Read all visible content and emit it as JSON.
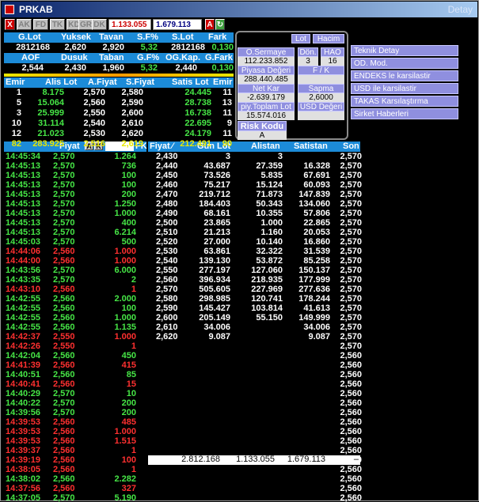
{
  "title": "PRKAB",
  "title_right": "Detay",
  "toolbar": {
    "close": "X",
    "buttons": [
      "AK",
      "FD",
      "TK",
      "KD",
      "GR",
      "DK"
    ],
    "field1": "1.133.055",
    "field2": "1.679.113",
    "a_btn": "A",
    "arrow": "↻"
  },
  "summary1": {
    "headers": [
      "G.Lot",
      "Yuksek",
      "Tavan",
      "S.F%",
      "S.Lot",
      "Fark"
    ],
    "values": [
      "2812168",
      "2,620",
      "2,920",
      "5,32",
      "2812168",
      "0,130"
    ]
  },
  "summary2": {
    "headers": [
      "AOF",
      "Dusuk",
      "Taban",
      "G.F%",
      "OG.Kap.",
      "G.Fark"
    ],
    "values": [
      "2,544",
      "2,430",
      "1,960",
      "5,32",
      "2,440",
      "0,130"
    ]
  },
  "orderbook": {
    "headers": [
      "Emir",
      "Alis Lot",
      "A.Fiyat",
      "S.Fiyat",
      "Satis Lot",
      "Emir"
    ],
    "rows": [
      [
        "1",
        "8.175",
        "2,570",
        "2,580",
        "24.445",
        "11"
      ],
      [
        "5",
        "15.064",
        "2,560",
        "2,590",
        "28.738",
        "13"
      ],
      [
        "3",
        "25.999",
        "2,550",
        "2,600",
        "16.738",
        "11"
      ],
      [
        "10",
        "31.114",
        "2,540",
        "2,610",
        "22.695",
        "9"
      ],
      [
        "12",
        "21.023",
        "2,530",
        "2,620",
        "24.179",
        "11"
      ]
    ],
    "totals": [
      "82",
      "283.925",
      "2,516",
      "2,619",
      "212.491",
      "90"
    ]
  },
  "info": {
    "lot_btn": "Lot",
    "hacim_btn": "Hacim",
    "osermaye_label": "O.Sermaye",
    "osermaye_value": "112.233.852",
    "don_label": "Dön.",
    "don_value": "3",
    "hao_label": "HAO",
    "hao_value": "16",
    "piyasa_label": "Piyasa Değeri",
    "piyasa_value": "288.440.485",
    "fk_label": "F / K",
    "fk_value": "",
    "netkar_label": "Net Kar",
    "netkar_value": "-2.639.179",
    "sapma_label": "Sapma",
    "sapma_value": "2,6000",
    "toplamlot_label": "piy.Toplam Lot",
    "toplamlot_value": "15.574.016",
    "usd_label": "USD Değeri",
    "usd_value": "",
    "risk_label": "Risk Kodu",
    "risk_value": "A"
  },
  "right_buttons": [
    "Teknik Detay",
    "OD. Mod.",
    "ENDEKS le karsilastir",
    "USD ile karsilastir",
    "TAKAS Karsılaştırma",
    "Sirket Haberleri"
  ],
  "ticks_header": {
    "fiyat": "Fiyat",
    "a": "A",
    "k": "K",
    "fk": "FK"
  },
  "ticks": [
    [
      "14:45:34",
      "2,570",
      "1.264",
      "g"
    ],
    [
      "14:45:13",
      "2,570",
      "736",
      "g"
    ],
    [
      "14:45:13",
      "2,570",
      "100",
      "g"
    ],
    [
      "14:45:13",
      "2,570",
      "100",
      "g"
    ],
    [
      "14:45:13",
      "2,570",
      "200",
      "g"
    ],
    [
      "14:45:13",
      "2,570",
      "1.250",
      "g"
    ],
    [
      "14:45:13",
      "2,570",
      "1.000",
      "g"
    ],
    [
      "14:45:13",
      "2,570",
      "400",
      "g"
    ],
    [
      "14:45:13",
      "2,570",
      "6.214",
      "g"
    ],
    [
      "14:45:03",
      "2,570",
      "500",
      "g"
    ],
    [
      "14:44:06",
      "2,560",
      "1.000",
      "r"
    ],
    [
      "14:44:00",
      "2,560",
      "1.000",
      "r"
    ],
    [
      "14:43:56",
      "2,570",
      "6.000",
      "g"
    ],
    [
      "14:43:35",
      "2,570",
      "2",
      "g"
    ],
    [
      "14:43:10",
      "2,560",
      "1",
      "r"
    ],
    [
      "14:42:55",
      "2,560",
      "2.000",
      "g"
    ],
    [
      "14:42:55",
      "2,560",
      "100",
      "g"
    ],
    [
      "14:42:55",
      "2,560",
      "1.000",
      "g"
    ],
    [
      "14:42:55",
      "2,560",
      "1.135",
      "g"
    ],
    [
      "14:42:37",
      "2,550",
      "1.000",
      "r"
    ],
    [
      "14:42:26",
      "2,550",
      "1",
      "r"
    ],
    [
      "14:42:04",
      "2,560",
      "450",
      "g"
    ],
    [
      "14:41:39",
      "2,560",
      "415",
      "r"
    ],
    [
      "14:40:51",
      "2,560",
      "85",
      "g"
    ],
    [
      "14:40:41",
      "2,560",
      "15",
      "r"
    ],
    [
      "14:40:29",
      "2,570",
      "10",
      "g"
    ],
    [
      "14:40:22",
      "2,570",
      "200",
      "g"
    ],
    [
      "14:39:56",
      "2,570",
      "200",
      "g"
    ],
    [
      "14:39:53",
      "2,560",
      "485",
      "r"
    ],
    [
      "14:39:53",
      "2,560",
      "1.000",
      "r"
    ],
    [
      "14:39:53",
      "2,560",
      "1.515",
      "r"
    ],
    [
      "14:39:37",
      "2,560",
      "1",
      "r"
    ],
    [
      "14:39:19",
      "2,560",
      "100",
      "r"
    ],
    [
      "14:38:05",
      "2,560",
      "1",
      "r"
    ],
    [
      "14:38:02",
      "2,560",
      "2.282",
      "g"
    ],
    [
      "14:37:56",
      "2,560",
      "327",
      "r"
    ],
    [
      "14:37:05",
      "2,570",
      "5.190",
      "g"
    ]
  ],
  "depth_header": [
    "Fiyat",
    "Gun Lot",
    "Alistan",
    "Satistan",
    "Son"
  ],
  "depth": [
    [
      "2,430",
      "3",
      "3",
      ""
    ],
    [
      "2,440",
      "43.687",
      "27.359",
      "16.328"
    ],
    [
      "2,450",
      "73.526",
      "5.835",
      "67.691"
    ],
    [
      "2,460",
      "75.217",
      "15.124",
      "60.093"
    ],
    [
      "2,470",
      "219.712",
      "71.873",
      "147.839"
    ],
    [
      "2,480",
      "184.403",
      "50.343",
      "134.060"
    ],
    [
      "2,490",
      "68.161",
      "10.355",
      "57.806"
    ],
    [
      "2,500",
      "23.865",
      "1.000",
      "22.865"
    ],
    [
      "2,510",
      "21.213",
      "1.160",
      "20.053"
    ],
    [
      "2,520",
      "27.000",
      "10.140",
      "16.860"
    ],
    [
      "2,530",
      "63.861",
      "32.322",
      "31.539"
    ],
    [
      "2,540",
      "139.130",
      "53.872",
      "85.258"
    ],
    [
      "2,550",
      "277.197",
      "127.060",
      "150.137"
    ],
    [
      "2,560",
      "396.934",
      "218.935",
      "177.999"
    ],
    [
      "2,570",
      "505.605",
      "227.969",
      "277.636"
    ],
    [
      "2,580",
      "298.985",
      "120.741",
      "178.244"
    ],
    [
      "2,590",
      "145.427",
      "103.814",
      "41.613"
    ],
    [
      "2,600",
      "205.149",
      "55.150",
      "149.999"
    ],
    [
      "2,610",
      "34.006",
      "",
      "34.006"
    ],
    [
      "2,620",
      "9.087",
      "",
      "9.087"
    ]
  ],
  "son": [
    "2,570",
    "2,570",
    "2,570",
    "2,570",
    "2,570",
    "2,570",
    "2,570",
    "2,570",
    "2,570",
    "2,570",
    "2,570",
    "2,570",
    "2,570",
    "2,570",
    "2,570",
    "2,570",
    "2,570",
    "2,570",
    "2,570",
    "2,570",
    "2,570",
    "2,560",
    "2,560",
    "2,560",
    "2,560",
    "2,560",
    "2,560",
    "2,560",
    "2,560",
    "2,560",
    "2,560",
    "2,560",
    "2,560",
    "2,560",
    "2,560",
    "2,560",
    "2,560"
  ],
  "depth_totals": [
    "2.812.168",
    "1.133.055",
    "1.679.113"
  ],
  "colors": {
    "green": "#46e646",
    "red": "#ff3030",
    "yellow": "#e8e800",
    "header_blue": "#1c8bd8",
    "button_purple": "#8f8fdf"
  }
}
